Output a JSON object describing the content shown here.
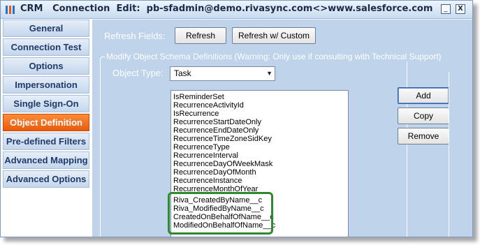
{
  "window": {
    "title_parts": [
      "CRM",
      "Connection",
      "Edit:",
      "pb-sfadmin@demo.rivasync.com<>www.salesforce.com"
    ],
    "minimize_label": "_",
    "close_label": "X"
  },
  "sidebar": {
    "items": [
      {
        "label": "General",
        "active": false
      },
      {
        "label": "Connection Test",
        "active": false
      },
      {
        "label": "Options",
        "active": false
      },
      {
        "label": "Impersonation",
        "active": false
      },
      {
        "label": "Single Sign-On",
        "active": false
      },
      {
        "label": "Object Definition",
        "active": true
      },
      {
        "label": "Pre-defined Filters",
        "active": false
      },
      {
        "label": "Advanced Mapping",
        "active": false
      },
      {
        "label": "Advanced Options",
        "active": false
      }
    ]
  },
  "main": {
    "refresh_fields_label": "Refresh Fields:",
    "refresh_button": "Refresh",
    "refresh_custom_button": "Refresh w/ Custom",
    "group_legend": "Modify Object Schema Definitions (Warning: Only use if consulting with Technical Support)",
    "object_type_label": "Object Type:",
    "object_type_value": "Task",
    "add_button": "Add",
    "copy_button": "Copy",
    "remove_button": "Remove",
    "fields": [
      "IsReminderSet",
      "RecurrenceActivityId",
      "IsRecurrence",
      "RecurrenceStartDateOnly",
      "RecurrenceEndDateOnly",
      "RecurrenceTimeZoneSidKey",
      "RecurrenceType",
      "RecurrenceInterval",
      "RecurrenceDayOfWeekMask",
      "RecurrenceDayOfMonth",
      "RecurrenceInstance",
      "RecurrenceMonthOfYear",
      "Riva_CreatedByName__c",
      "Riva_ModifiedByName__c",
      "CreatedOnBehalfOfName__c",
      "ModifiedOnBehalfOfName__c"
    ]
  },
  "colors": {
    "active_nav": "#e85a0c",
    "highlight_border": "#2f8a2f",
    "content_bg": "#bfd3ea"
  }
}
